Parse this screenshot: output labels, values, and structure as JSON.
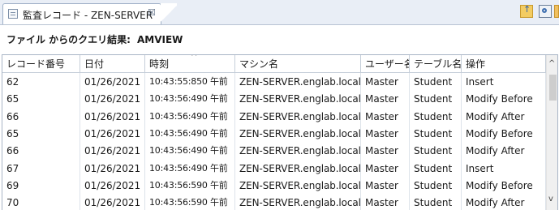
{
  "tab": {
    "title": "監査レコード - ZEN-SERVER",
    "close_glyph": "☒"
  },
  "query": {
    "label": "ファイル からのクエリ結果:",
    "value": "AMVIEW"
  },
  "table": {
    "columns": [
      "レコード番号",
      "日付",
      "時刻",
      "マシン名",
      "ユーザー名",
      "テーブル名",
      "操作"
    ],
    "sort_glyph": "^",
    "rows": [
      [
        "62",
        "01/26/2021",
        "10:43:55:850 午前",
        "ZEN-SERVER.englab.local",
        "Master",
        "Student",
        "Insert"
      ],
      [
        "65",
        "01/26/2021",
        "10:43:56:490 午前",
        "ZEN-SERVER.englab.local",
        "Master",
        "Student",
        "Modify Before"
      ],
      [
        "66",
        "01/26/2021",
        "10:43:56:490 午前",
        "ZEN-SERVER.englab.local",
        "Master",
        "Student",
        "Modify After"
      ],
      [
        "65",
        "01/26/2021",
        "10:43:56:490 午前",
        "ZEN-SERVER.englab.local",
        "Master",
        "Student",
        "Modify Before"
      ],
      [
        "66",
        "01/26/2021",
        "10:43:56:490 午前",
        "ZEN-SERVER.englab.local",
        "Master",
        "Student",
        "Modify After"
      ],
      [
        "67",
        "01/26/2021",
        "10:43:56:490 午前",
        "ZEN-SERVER.englab.local",
        "Master",
        "Student",
        "Insert"
      ],
      [
        "69",
        "01/26/2021",
        "10:43:56:590 午前",
        "ZEN-SERVER.englab.local",
        "Master",
        "Student",
        "Modify Before"
      ],
      [
        "70",
        "01/26/2021",
        "10:43:56:590 午前",
        "ZEN-SERVER.englab.local",
        "Master",
        "Student",
        "Modify After"
      ]
    ]
  },
  "scrollbar": {
    "up_glyph": "^",
    "down_glyph": "v"
  },
  "icons": {
    "tab": "table-view-icon",
    "toolbar": [
      "up-folder-icon",
      "find-icon",
      "grid-view-icon"
    ]
  }
}
